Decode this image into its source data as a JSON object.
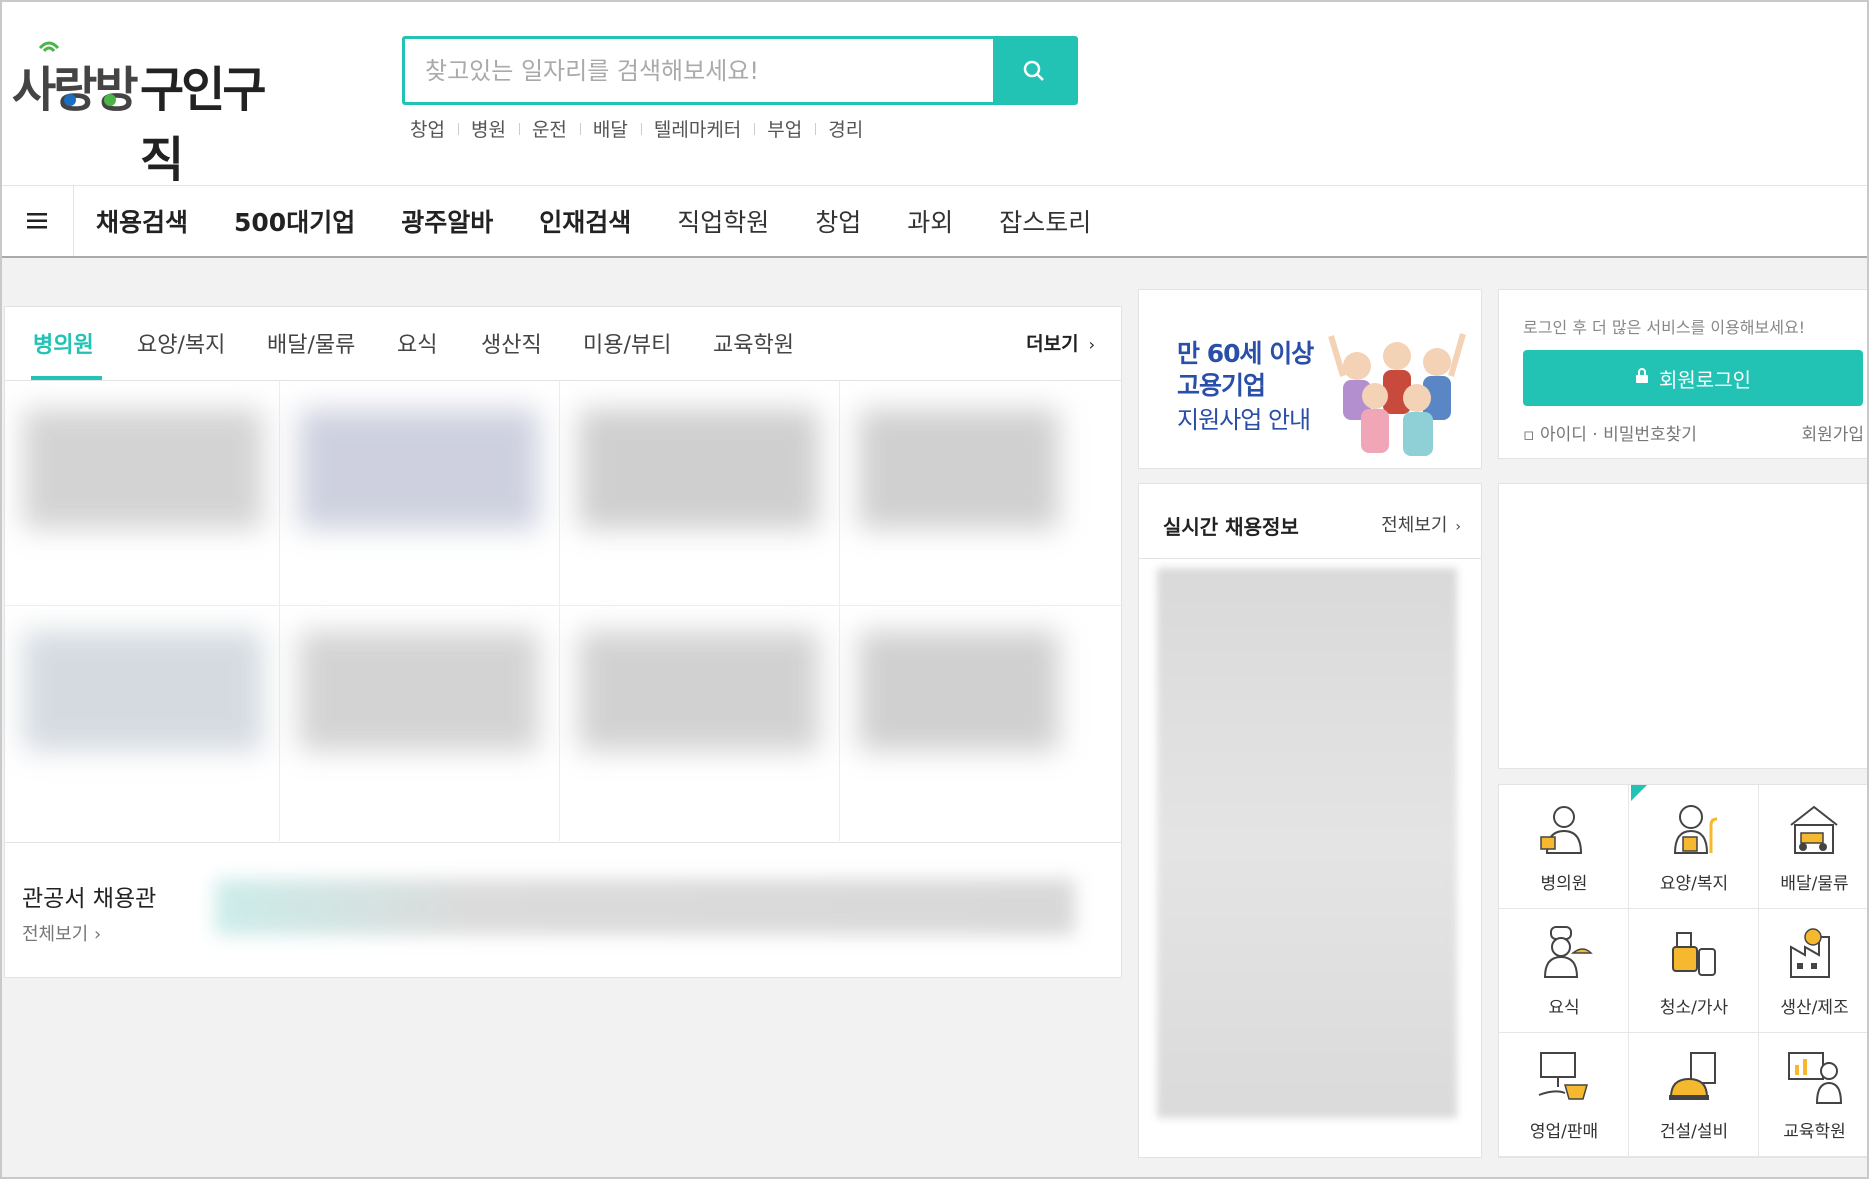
{
  "header": {
    "logo_text_1": "사랑방",
    "logo_text_2": "구인구직",
    "search_placeholder": "찾고있는 일자리를 검색해보세요!",
    "search_icon": "search-icon",
    "keywords": [
      "창업",
      "병원",
      "운전",
      "배달",
      "텔레마케터",
      "부업",
      "경리"
    ]
  },
  "nav": {
    "menu_icon": "hamburger-icon",
    "items": [
      "채용검색",
      "500대기업",
      "광주알바",
      "인재검색",
      "직업학원",
      "창업",
      "과외",
      "잡스토리"
    ]
  },
  "main": {
    "tabs": [
      "병의원",
      "요양/복지",
      "배달/물류",
      "요식",
      "생산직",
      "미용/뷰티",
      "교육학원"
    ],
    "more_label": "더보기",
    "gov": {
      "title": "관공서 채용관",
      "more_label": "전체보기"
    }
  },
  "banner": {
    "line1": "만 60세 이상",
    "line2": "고용기업",
    "line3": "지원사업 안내"
  },
  "realtime": {
    "title": "실시간 채용정보",
    "more_label": "전체보기"
  },
  "login": {
    "message": "로그인 후 더 많은 서비스를 이용해보세요!",
    "button_label": "회원로그인",
    "find_label": "아이디 · 비밀번호찾기",
    "join_label": "회원가입"
  },
  "categories": [
    {
      "label": "병의원",
      "icon": "doctor-icon"
    },
    {
      "label": "요양/복지",
      "icon": "caregiver-icon"
    },
    {
      "label": "배달/물류",
      "icon": "delivery-scooter-icon"
    },
    {
      "label": "요식",
      "icon": "chef-icon"
    },
    {
      "label": "청소/가사",
      "icon": "cleaning-icon"
    },
    {
      "label": "생산/제조",
      "icon": "factory-icon"
    },
    {
      "label": "영업/판매",
      "icon": "sales-icon"
    },
    {
      "label": "건설/설비",
      "icon": "construction-icon"
    },
    {
      "label": "교육학원",
      "icon": "teacher-icon"
    }
  ],
  "colors": {
    "accent": "#22c3b4",
    "banner_text": "#2a4fa8"
  }
}
